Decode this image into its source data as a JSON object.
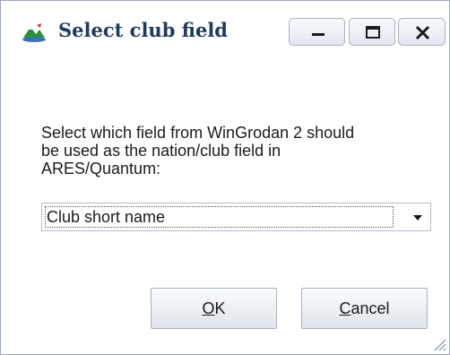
{
  "window": {
    "title": "Select club field",
    "icon": "app-icon",
    "controls": {
      "minimize": "minimize-icon",
      "maximize": "maximize-icon",
      "close": "close-icon"
    }
  },
  "dialog": {
    "prompt_lines": [
      "Select which field from WinGrodan 2 should",
      "be used as the nation/club field in",
      "ARES/Quantum:"
    ],
    "field_select": {
      "selected": "Club short name",
      "arrow_icon": "chevron-down-icon"
    },
    "ok_button": {
      "label": "OK",
      "mnemonic": "O",
      "rest": "K"
    },
    "cancel_button": {
      "label": "Cancel",
      "mnemonic": "C",
      "rest": "ancel"
    }
  },
  "colors": {
    "title_text": "#1f3b5c",
    "border": "#9ca9bb"
  }
}
